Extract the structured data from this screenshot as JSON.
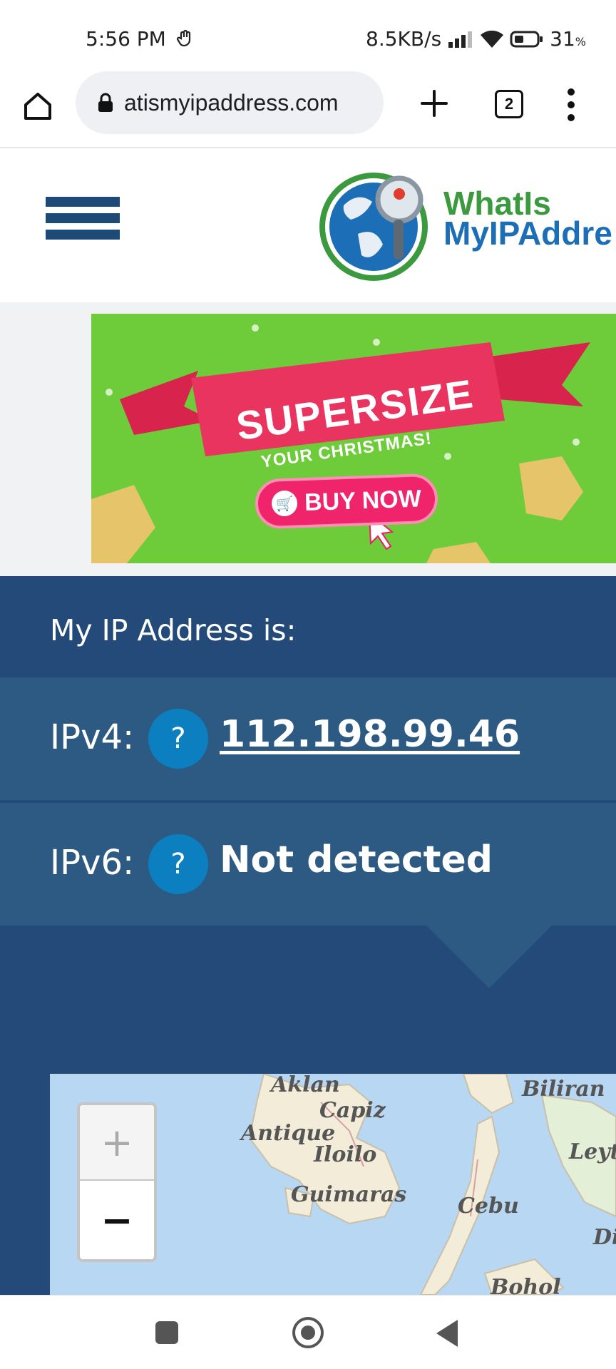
{
  "status_bar": {
    "time": "5:56 PM",
    "net_speed": "8.5KB/s",
    "battery": "31",
    "battery_unit": "%",
    "icons": [
      "hand-icon",
      "signal-icon",
      "wifi-icon",
      "battery-icon"
    ]
  },
  "browser": {
    "url": "atismyipaddress.com",
    "tab_count": "2",
    "icons": [
      "home-icon",
      "lock-icon",
      "plus-icon",
      "tabs-icon",
      "more-icon"
    ]
  },
  "site": {
    "logo_line1": "WhatIs",
    "logo_line2": "MyIPAddre",
    "brand_colors": {
      "green": "#3c9a3e",
      "blue": "#1c6fb7",
      "navy": "#1e4a77"
    }
  },
  "ad": {
    "title": "SUPERSIZE",
    "subtitle": "YOUR CHRISTMAS!",
    "cta": "BUY NOW"
  },
  "ip_panel": {
    "heading": "My IP Address is:",
    "rows": [
      {
        "label": "IPv4:",
        "help": "?",
        "value": "112.198.99.46"
      },
      {
        "label": "IPv6:",
        "help": "?",
        "value": "Not detected"
      }
    ],
    "colors": {
      "panel": "#234a78",
      "row": "#2d5a83",
      "badge": "#0b7fc0"
    }
  },
  "map": {
    "labels": [
      "Aklan",
      "Capiz",
      "Antique",
      "Iloilo",
      "Guimaras",
      "Cebu",
      "Biliran",
      "Leyt",
      "Di",
      "Bohol"
    ],
    "zoom_in": "+",
    "zoom_out": "−"
  }
}
